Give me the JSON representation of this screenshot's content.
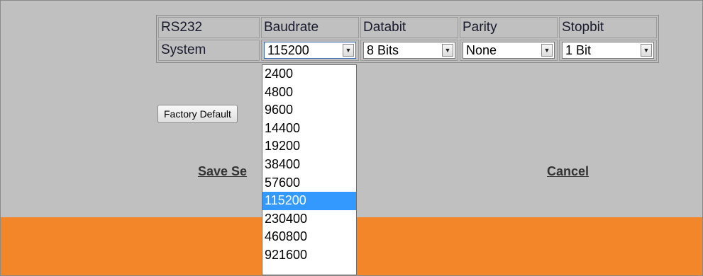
{
  "table": {
    "headers": [
      "RS232",
      "Baudrate",
      "Databit",
      "Parity",
      "Stopbit"
    ],
    "row_label": "System",
    "baudrate_value": "115200",
    "databit_value": "8 Bits",
    "parity_value": "None",
    "stopbit_value": "1 Bit"
  },
  "buttons": {
    "factory_default": "Factory Default"
  },
  "links": {
    "save": "Save Se",
    "cancel": "Cancel"
  },
  "baudrate_dropdown": {
    "options": [
      "2400",
      "4800",
      "9600",
      "14400",
      "19200",
      "38400",
      "57600",
      "115200",
      "230400",
      "460800",
      "921600"
    ],
    "selected": "115200"
  },
  "colors": {
    "panel": "#c0c0c0",
    "footer": "#f4862a",
    "highlight": "#3399ff"
  }
}
